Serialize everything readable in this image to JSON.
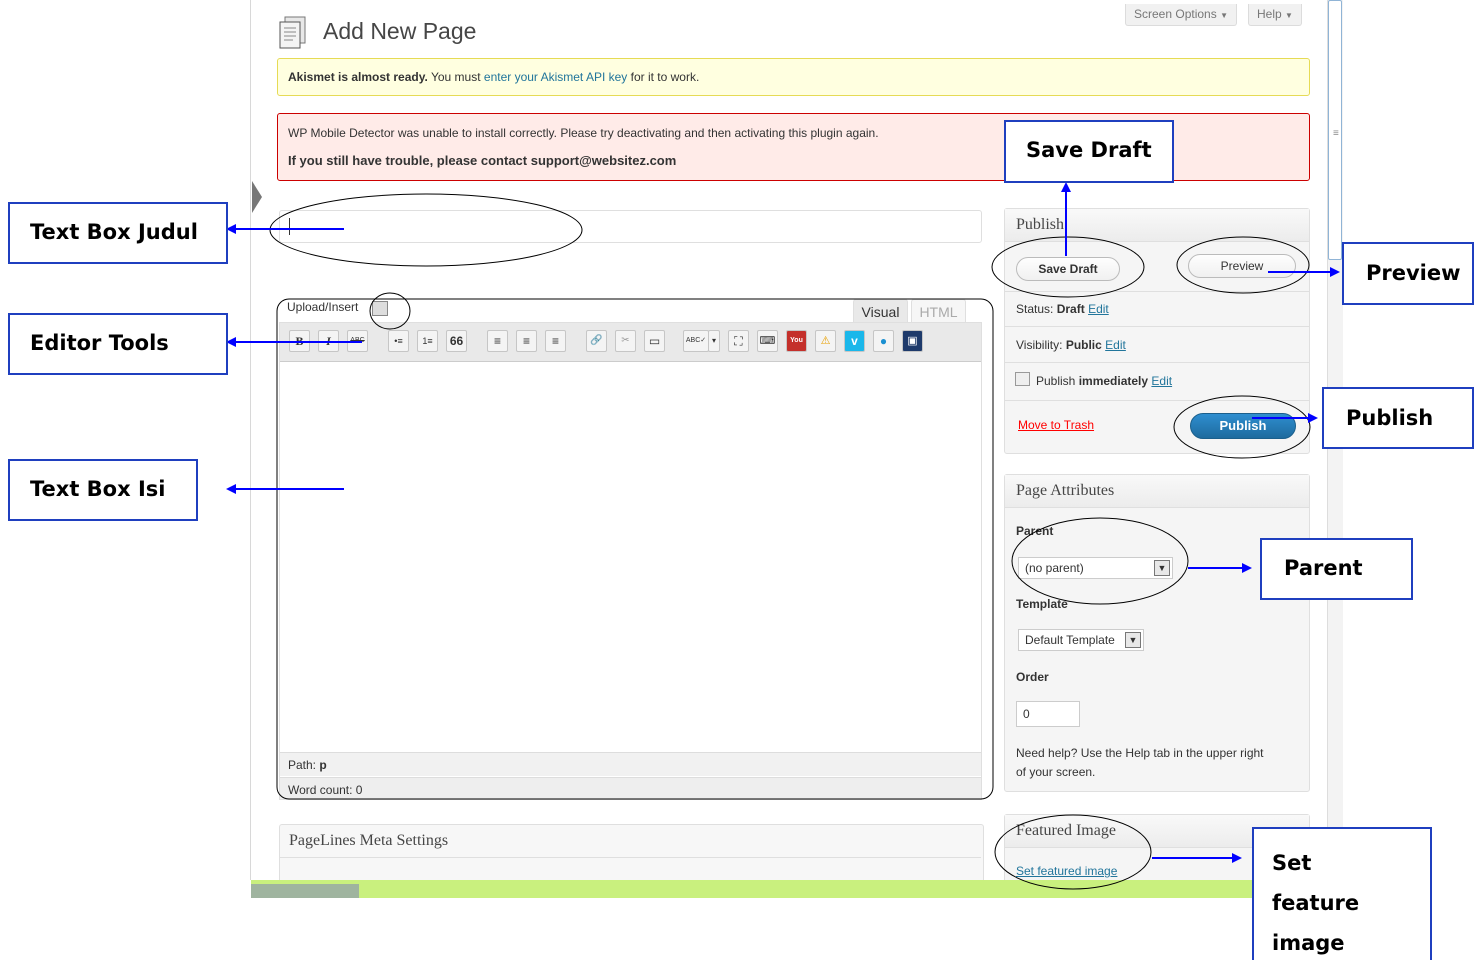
{
  "header": {
    "page_title": "Add New Page",
    "screen_options_label": "Screen Options",
    "help_label": "Help",
    "dropdown_glyph": "▼"
  },
  "notices": {
    "akismet": {
      "bold": "Akismet is almost ready.",
      "text_before_link": " You must ",
      "link": "enter your Akismet API key",
      "text_after_link": " for it to work."
    },
    "mobile_detector": {
      "line1": "WP Mobile Detector was unable to install correctly. Please try deactivating and then activating this plugin again.",
      "line2": "If you still have trouble, please contact support@websitez.com"
    }
  },
  "editor": {
    "title_value": "",
    "upload_insert_label": "Upload/Insert",
    "tabs": {
      "visual": "Visual",
      "html": "HTML"
    },
    "toolbar": [
      "B",
      "I",
      "ABC",
      "•≡",
      "1≡",
      "66",
      "≡",
      "≡",
      "≡",
      "🔗",
      "✂",
      "▭",
      "ABC✓",
      "▾",
      "⛶",
      "⌨",
      "You",
      "⚠",
      "v",
      "●",
      "▣"
    ],
    "path_label": "Path:",
    "path_value": "p",
    "word_count": "Word count: 0"
  },
  "pagelines": {
    "title": "PageLines Meta Settings"
  },
  "publish_box": {
    "title": "Publish",
    "save_draft": "Save Draft",
    "preview": "Preview",
    "status_label": "Status:",
    "status_value": "Draft",
    "visibility_label": "Visibility:",
    "visibility_value": "Public",
    "publish_label": "Publish",
    "publish_value": "immediately",
    "edit_link": "Edit",
    "move_to_trash": "Move to Trash",
    "publish_button": "Publish"
  },
  "page_attributes": {
    "title": "Page Attributes",
    "parent_label": "Parent",
    "parent_value": "(no parent)",
    "template_label": "Template",
    "template_value": "Default Template",
    "order_label": "Order",
    "order_value": "0",
    "help_line1": "Need help? Use the Help tab in the upper right",
    "help_line2": "of your screen."
  },
  "featured_image": {
    "title": "Featured Image",
    "set_link": "Set featured image"
  },
  "annotations": {
    "text_box_judul": "Text Box Judul",
    "editor_tools": "Editor Tools",
    "text_box_isi": "Text Box Isi",
    "save_draft": "Save Draft",
    "preview": "Preview",
    "publish": "Publish",
    "parent": "Parent",
    "set_feature_image": [
      "Set",
      "feature",
      "image"
    ]
  },
  "colors": {
    "callout_border": "#1f3fbf",
    "arrow": "#0000ff",
    "wp_link": "#21759b",
    "publish_button": "#2e8ed0",
    "trash_red": "#ff0000",
    "akismet_bg": "#ffffe0",
    "error_bg": "#ffebe8",
    "bottom_bar": "#c9f07e"
  }
}
